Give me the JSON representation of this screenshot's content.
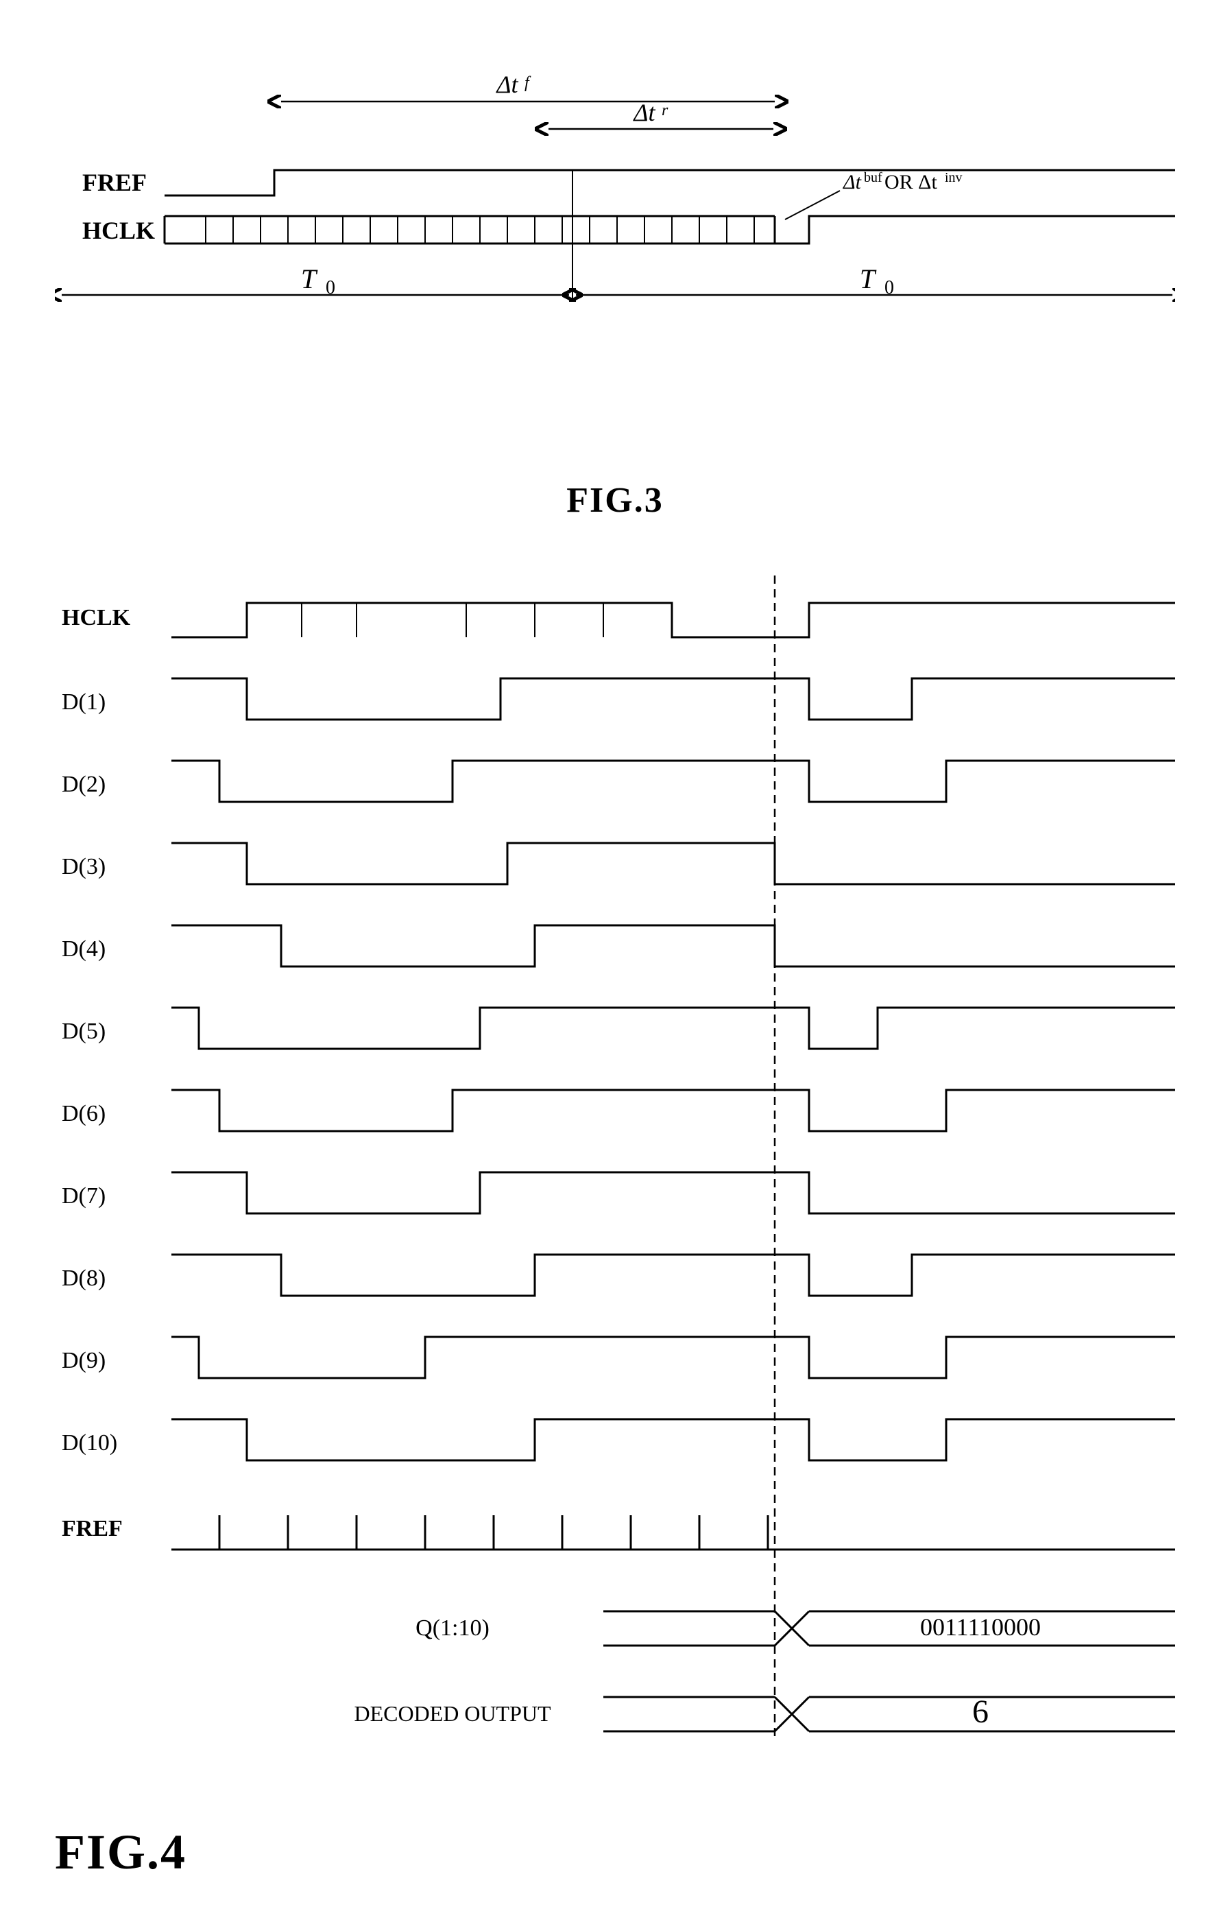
{
  "fig3": {
    "label": "FIG.3",
    "signals": {
      "fref_label": "FREF",
      "hclk_label": "HCLK",
      "t0_label": "T₀",
      "delta_tf_label": "Δtᶠ",
      "delta_tr_label": "Δtᴿ",
      "delta_tbuf_label": "Δtᵈᵘᶠ OR Δtᶢⁿᵛ"
    }
  },
  "fig4": {
    "label": "FIG.4",
    "signals": {
      "hclk": "HCLK",
      "d1": "D(1)",
      "d2": "D(2)",
      "d3": "D(3)",
      "d4": "D(4)",
      "d5": "D(5)",
      "d6": "D(6)",
      "d7": "D(7)",
      "d8": "D(8)",
      "d9": "D(9)",
      "d10": "D(10)",
      "fref": "FREF",
      "q110": "Q(1:10)",
      "decoded": "DECODED OUTPUT",
      "q110_val": "0011110000",
      "decoded_val": "6"
    }
  }
}
